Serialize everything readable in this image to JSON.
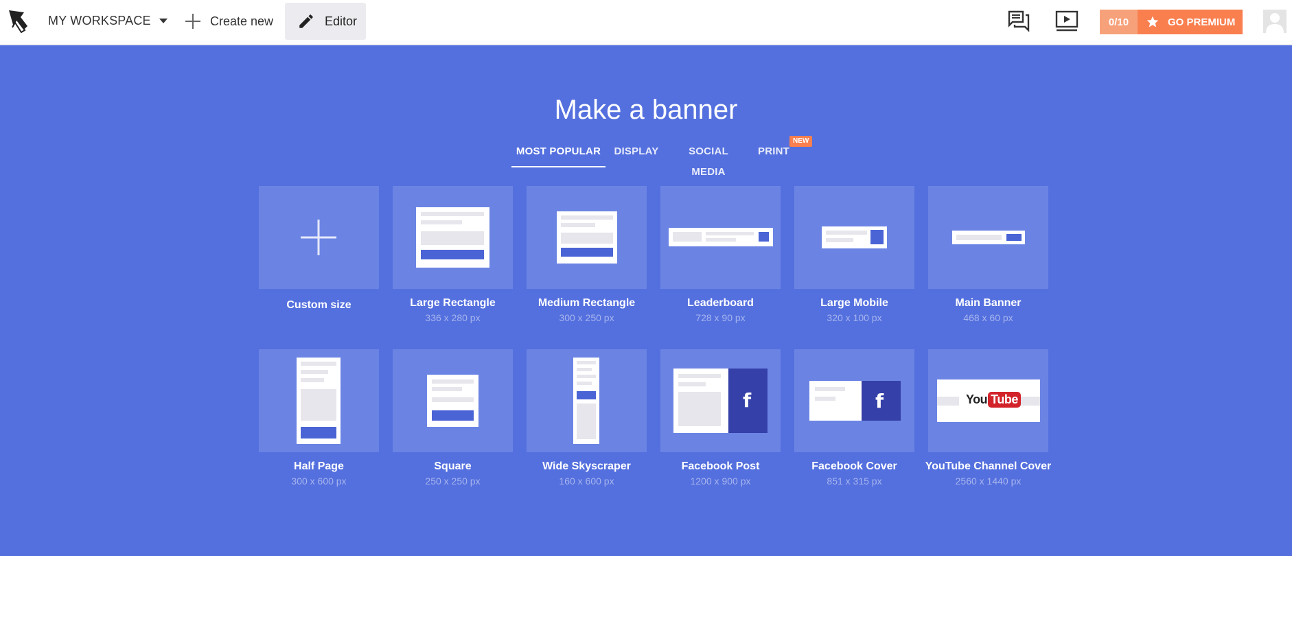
{
  "header": {
    "workspace_label": "MY WORKSPACE",
    "create_new_label": "Create new",
    "editor_label": "Editor",
    "premium_count": "0/10",
    "premium_label": "GO PREMIUM"
  },
  "colors": {
    "hero_bg": "#5470de",
    "tile_bg": "#6b84e4",
    "premium_orange": "#f97f4f",
    "accent_blue": "#4a64d6"
  },
  "hero": {
    "title": "Make a banner",
    "tabs": [
      {
        "label": "MOST POPULAR",
        "active": true
      },
      {
        "label": "DISPLAY",
        "active": false
      },
      {
        "label": "SOCIAL MEDIA",
        "active": false
      },
      {
        "label": "PRINT",
        "active": false
      }
    ],
    "new_badge": "NEW"
  },
  "templates": [
    {
      "name": "Custom size",
      "size": ""
    },
    {
      "name": "Large Rectangle",
      "size": "336 x 280 px"
    },
    {
      "name": "Medium Rectangle",
      "size": "300 x 250 px"
    },
    {
      "name": "Leaderboard",
      "size": "728 x 90 px"
    },
    {
      "name": "Large Mobile",
      "size": "320 x 100 px"
    },
    {
      "name": "Main Banner",
      "size": "468 x 60 px"
    },
    {
      "name": "Half Page",
      "size": "300 x 600 px"
    },
    {
      "name": "Square",
      "size": "250 x 250 px"
    },
    {
      "name": "Wide Skyscraper",
      "size": "160 x 600 px"
    },
    {
      "name": "Facebook Post",
      "size": "1200 x 900 px"
    },
    {
      "name": "Facebook Cover",
      "size": "851 x 315 px"
    },
    {
      "name": "YouTube Channel Cover",
      "size": "2560 x 1440 px"
    }
  ],
  "icons": {
    "logo": "cursor-logo-icon",
    "create": "plus-icon",
    "editor": "pencil-icon",
    "comments": "chat-icon",
    "tutorial": "play-video-icon",
    "premium": "star-icon",
    "account": "avatar-icon",
    "facebook": "facebook-f-icon"
  },
  "youtube_logo": {
    "you": "You",
    "tube": "Tube"
  },
  "facebook_glyph": "f"
}
